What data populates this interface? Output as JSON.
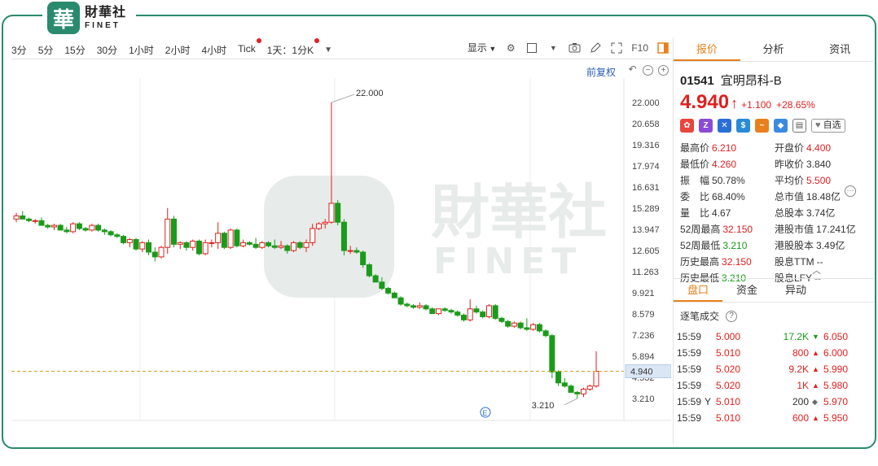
{
  "brand": {
    "seal": "華",
    "name_cn": "財華社",
    "name_en": "FINET"
  },
  "toolbar": {
    "timeframes": [
      {
        "label": "3分",
        "dot": false
      },
      {
        "label": "5分",
        "dot": false
      },
      {
        "label": "15分",
        "dot": false
      },
      {
        "label": "30分",
        "dot": false
      },
      {
        "label": "1小时",
        "dot": false
      },
      {
        "label": "2小时",
        "dot": false
      },
      {
        "label": "4小时",
        "dot": false
      },
      {
        "label": "Tick",
        "dot": true
      },
      {
        "label": "1天：1分K",
        "dot": true
      }
    ],
    "display_label": "显示",
    "f10_label": "F10",
    "adjust_label": "前复权"
  },
  "chart_data": {
    "type": "candlestick",
    "watermark": {
      "cn": "財華社",
      "en": "FINET"
    },
    "y_ticks": [
      "22.000",
      "20.658",
      "19.316",
      "17.974",
      "16.631",
      "15.289",
      "13.947",
      "12.605",
      "11.263",
      "9.921",
      "8.579",
      "7.236",
      "5.894",
      "4.532",
      "3.210"
    ],
    "ylim": [
      3.21,
      22.0
    ],
    "last_price": "4.940",
    "annotations": {
      "high": "22.000",
      "low": "3.210"
    },
    "event_marker": "E",
    "candles": [
      [
        14.6,
        15.0,
        14.4,
        14.8
      ],
      [
        14.8,
        15.1,
        14.6,
        14.6
      ],
      [
        14.6,
        14.7,
        14.4,
        14.5
      ],
      [
        14.5,
        14.6,
        14.3,
        14.5
      ],
      [
        14.5,
        14.7,
        14.2,
        14.2
      ],
      [
        14.2,
        14.3,
        14.0,
        14.1
      ],
      [
        14.1,
        14.3,
        13.9,
        14.2
      ],
      [
        14.2,
        14.3,
        13.9,
        13.9
      ],
      [
        13.9,
        14.1,
        13.7,
        13.8
      ],
      [
        13.8,
        14.4,
        13.7,
        14.3
      ],
      [
        14.3,
        14.4,
        13.9,
        14.0
      ],
      [
        14.0,
        14.1,
        13.8,
        13.9
      ],
      [
        13.9,
        14.3,
        13.8,
        14.2
      ],
      [
        14.2,
        14.3,
        13.8,
        13.9
      ],
      [
        13.9,
        14.0,
        13.6,
        13.8
      ],
      [
        13.8,
        13.9,
        13.5,
        13.6
      ],
      [
        13.6,
        13.7,
        13.4,
        13.5
      ],
      [
        13.5,
        13.6,
        13.0,
        13.1
      ],
      [
        13.1,
        13.4,
        12.8,
        13.3
      ],
      [
        13.3,
        13.4,
        12.6,
        12.7
      ],
      [
        12.7,
        13.2,
        12.5,
        13.1
      ],
      [
        13.1,
        13.3,
        12.3,
        12.5
      ],
      [
        12.5,
        12.8,
        11.9,
        12.2
      ],
      [
        12.2,
        12.9,
        12.1,
        12.8
      ],
      [
        12.8,
        15.3,
        12.4,
        14.6
      ],
      [
        14.6,
        14.8,
        12.8,
        13.0
      ],
      [
        13.0,
        13.2,
        12.7,
        13.1
      ],
      [
        13.1,
        13.2,
        12.6,
        12.8
      ],
      [
        12.8,
        13.3,
        12.6,
        13.2
      ],
      [
        13.2,
        13.3,
        12.3,
        12.4
      ],
      [
        12.4,
        13.3,
        12.3,
        13.1
      ],
      [
        13.1,
        13.3,
        12.8,
        13.1
      ],
      [
        13.1,
        14.4,
        12.7,
        13.7
      ],
      [
        13.7,
        13.8,
        12.7,
        12.8
      ],
      [
        12.8,
        14.0,
        12.7,
        13.9
      ],
      [
        13.9,
        14.0,
        12.8,
        12.9
      ],
      [
        12.9,
        13.3,
        12.8,
        13.1
      ],
      [
        13.1,
        13.2,
        12.9,
        13.0
      ],
      [
        13.0,
        13.4,
        12.7,
        12.8
      ],
      [
        12.8,
        13.2,
        12.7,
        13.1
      ],
      [
        13.1,
        13.2,
        12.8,
        12.9
      ],
      [
        12.9,
        13.3,
        12.7,
        12.8
      ],
      [
        12.8,
        13.2,
        12.7,
        12.9
      ],
      [
        12.9,
        13.0,
        12.4,
        12.6
      ],
      [
        12.6,
        13.2,
        12.5,
        13.1
      ],
      [
        13.1,
        13.2,
        12.7,
        12.8
      ],
      [
        12.8,
        13.3,
        12.5,
        13.1
      ],
      [
        13.1,
        14.3,
        12.9,
        14.0
      ],
      [
        14.0,
        14.4,
        13.9,
        14.3
      ],
      [
        14.3,
        14.6,
        14.0,
        14.4
      ],
      [
        14.4,
        22.0,
        14.3,
        15.6
      ],
      [
        15.6,
        15.8,
        14.2,
        14.4
      ],
      [
        14.4,
        14.6,
        12.3,
        12.6
      ],
      [
        12.6,
        12.9,
        12.4,
        12.6
      ],
      [
        12.6,
        12.8,
        12.4,
        12.5
      ],
      [
        12.5,
        12.6,
        11.5,
        11.7
      ],
      [
        11.7,
        11.8,
        10.9,
        11.0
      ],
      [
        11.0,
        11.1,
        10.6,
        10.6
      ],
      [
        10.6,
        10.9,
        10.1,
        10.2
      ],
      [
        10.2,
        10.3,
        9.8,
        9.9
      ],
      [
        9.9,
        10.0,
        9.6,
        9.6
      ],
      [
        9.6,
        9.7,
        9.1,
        9.2
      ],
      [
        9.2,
        9.3,
        9.0,
        9.1
      ],
      [
        9.1,
        9.2,
        8.9,
        9.0
      ],
      [
        9.0,
        9.3,
        8.9,
        9.1
      ],
      [
        9.1,
        9.2,
        8.8,
        8.9
      ],
      [
        8.9,
        9.0,
        8.6,
        8.6
      ],
      [
        8.6,
        8.9,
        8.5,
        8.9
      ],
      [
        8.9,
        9.0,
        8.7,
        8.8
      ],
      [
        8.8,
        8.9,
        8.6,
        8.7
      ],
      [
        8.7,
        8.8,
        8.4,
        8.5
      ],
      [
        8.5,
        8.6,
        8.1,
        8.2
      ],
      [
        8.2,
        9.5,
        8.1,
        8.9
      ],
      [
        8.9,
        9.1,
        8.6,
        8.7
      ],
      [
        8.7,
        8.8,
        8.3,
        8.4
      ],
      [
        8.4,
        9.2,
        8.3,
        9.1
      ],
      [
        9.1,
        9.2,
        8.2,
        8.3
      ],
      [
        8.3,
        8.4,
        8.0,
        8.1
      ],
      [
        8.1,
        8.2,
        7.7,
        7.8
      ],
      [
        7.8,
        8.1,
        7.7,
        8.0
      ],
      [
        8.0,
        8.1,
        7.6,
        7.7
      ],
      [
        7.7,
        8.3,
        7.5,
        7.6
      ],
      [
        7.6,
        8.0,
        7.5,
        7.9
      ],
      [
        7.9,
        8.0,
        7.4,
        7.5
      ],
      [
        7.5,
        7.6,
        7.1,
        7.2
      ],
      [
        7.2,
        7.3,
        4.5,
        4.9
      ],
      [
        4.9,
        5.0,
        4.0,
        4.2
      ],
      [
        4.2,
        4.5,
        3.9,
        4.0
      ],
      [
        4.0,
        4.1,
        3.6,
        3.6
      ],
      [
        3.6,
        3.7,
        3.21,
        3.5
      ],
      [
        3.5,
        3.9,
        3.3,
        3.8
      ],
      [
        3.8,
        4.1,
        3.7,
        4.0
      ],
      [
        4.0,
        6.21,
        3.9,
        4.94
      ]
    ]
  },
  "panel": {
    "tabs": [
      "报价",
      "分析",
      "资讯"
    ],
    "code": "01541",
    "name": "宜明昂科-B",
    "price": "4.940",
    "change": "+1.100",
    "change_pct": "+28.65%",
    "favorite_label": "自选",
    "stats": [
      {
        "label": "最高价",
        "value": "6.210",
        "color": "red"
      },
      {
        "label": "开盘价",
        "value": "4.400",
        "color": "red"
      },
      {
        "label": "最低价",
        "value": "4.260",
        "color": "red"
      },
      {
        "label": "昨收价",
        "value": "3.840",
        "color": "dark"
      },
      {
        "label": "振　幅",
        "value": "50.78%",
        "color": "dark"
      },
      {
        "label": "平均价",
        "value": "5.500",
        "color": "red"
      },
      {
        "label": "委　比",
        "value": "68.40%",
        "color": "dark"
      },
      {
        "label": "总市值",
        "value": "18.48亿",
        "color": "dark"
      },
      {
        "label": "量　比",
        "value": "4.67",
        "color": "dark"
      },
      {
        "label": "总股本",
        "value": "3.74亿",
        "color": "dark"
      },
      {
        "label": "52周最高",
        "value": "32.150",
        "color": "red"
      },
      {
        "label": "港股市值",
        "value": "17.241亿",
        "color": "dark"
      },
      {
        "label": "52周最低",
        "value": "3.210",
        "color": "green"
      },
      {
        "label": "港股股本",
        "value": "3.49亿",
        "color": "dark"
      },
      {
        "label": "历史最高",
        "value": "32.150",
        "color": "red"
      },
      {
        "label": "股息TTM",
        "value": "--",
        "color": "dark"
      },
      {
        "label": "历史最低",
        "value": "3.210",
        "color": "green"
      },
      {
        "label": "股息LFY",
        "value": "--",
        "color": "dark"
      }
    ],
    "subtabs": [
      "盘口",
      "资金",
      "异动"
    ],
    "ticks_title": "逐笔成交",
    "ticks": [
      {
        "time": "15:59",
        "flag": "",
        "price": "5.000",
        "vol": "17.2K",
        "dir": "down",
        "bid": "6.050"
      },
      {
        "time": "15:59",
        "flag": "",
        "price": "5.010",
        "vol": "800",
        "dir": "up",
        "bid": "6.000"
      },
      {
        "time": "15:59",
        "flag": "",
        "price": "5.020",
        "vol": "9.2K",
        "dir": "up",
        "bid": "5.990"
      },
      {
        "time": "15:59",
        "flag": "",
        "price": "5.020",
        "vol": "1K",
        "dir": "up",
        "bid": "5.980"
      },
      {
        "time": "15:59",
        "flag": "Y",
        "price": "5.010",
        "vol": "200",
        "dir": "neutral",
        "bid": "5.970"
      },
      {
        "time": "15:59",
        "flag": "",
        "price": "5.010",
        "vol": "600",
        "dir": "up",
        "bid": "5.950"
      }
    ]
  }
}
